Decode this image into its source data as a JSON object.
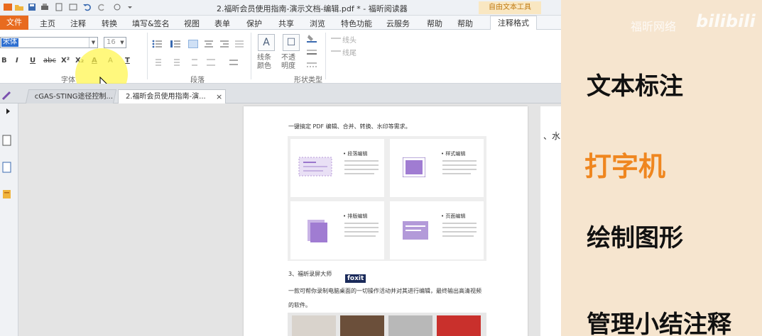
{
  "app": {
    "doc_title": "2.福昕会员使用指南-演示文档-编辑.pdf * - 福昕阅读器",
    "context_tab": "自由文本工具"
  },
  "menu": {
    "file": "文件",
    "tabs": [
      "主页",
      "注释",
      "转换",
      "填写&签名",
      "视图",
      "表单",
      "保护",
      "共享",
      "浏览",
      "特色功能",
      "云服务",
      "帮助",
      "帮助"
    ],
    "active": "注释格式"
  },
  "ribbon": {
    "font_value": "宋体",
    "font_size": "16",
    "groups": {
      "font": "字体",
      "paragraph": "段落",
      "shape_type": "形状类型"
    },
    "shape_buttons": {
      "border_color": "线条\n颜色",
      "opacity": "不透\n明度",
      "line_start": "线头",
      "line_end": "线尾"
    },
    "format_labels": [
      "B",
      "I",
      "U",
      "abc",
      "X²",
      "X₂",
      "A",
      "A",
      "T"
    ]
  },
  "tabs": {
    "doc1": "cGAS-STING途径控制...",
    "doc2": "2.福昕会员使用指南-演...",
    "close": "×"
  },
  "page": {
    "line1": "一键搞定 PDF 编辑、合并、转换、水印等需求。",
    "cards": [
      {
        "title": "• 段落编辑"
      },
      {
        "title": "• 样式编辑"
      },
      {
        "title": "• 排版编辑"
      },
      {
        "title": "• 页面编辑"
      }
    ],
    "section": "3、福昕录屏大师",
    "logo": "foxit",
    "desc": "一款可帮你录制电脑桌面的一切操作活动并对其进行编辑，最终输出高清视频",
    "desc2": "的软件。",
    "right_peek": "、水"
  },
  "side": {
    "watermark": "福昕网络",
    "bili": "bilibili",
    "items": [
      "文本标注",
      "打字机",
      "绘制图形",
      "管理小结注释"
    ],
    "accent_color": "#ef861f"
  }
}
